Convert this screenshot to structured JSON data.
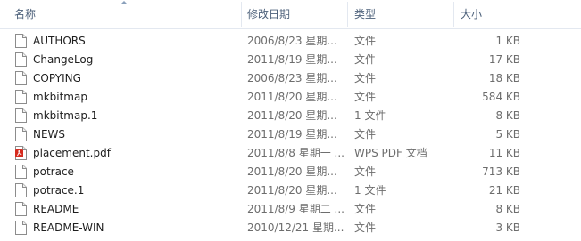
{
  "columns": {
    "name": "名称",
    "date": "修改日期",
    "type": "类型",
    "size": "大小"
  },
  "files": [
    {
      "name": "AUTHORS",
      "date": "2006/8/23 星期...",
      "type": "文件",
      "size": "1 KB",
      "icon": "file-icon"
    },
    {
      "name": "ChangeLog",
      "date": "2011/8/19 星期...",
      "type": "文件",
      "size": "17 KB",
      "icon": "file-icon"
    },
    {
      "name": "COPYING",
      "date": "2006/8/23 星期...",
      "type": "文件",
      "size": "18 KB",
      "icon": "file-icon"
    },
    {
      "name": "mkbitmap",
      "date": "2011/8/20 星期...",
      "type": "文件",
      "size": "584 KB",
      "icon": "file-icon"
    },
    {
      "name": "mkbitmap.1",
      "date": "2011/8/20 星期...",
      "type": "1 文件",
      "size": "8 KB",
      "icon": "file-icon"
    },
    {
      "name": "NEWS",
      "date": "2011/8/19 星期...",
      "type": "文件",
      "size": "5 KB",
      "icon": "file-icon"
    },
    {
      "name": "placement.pdf",
      "date": "2011/8/8 星期一 ...",
      "type": "WPS PDF 文档",
      "size": "11 KB",
      "icon": "pdf-icon"
    },
    {
      "name": "potrace",
      "date": "2011/8/20 星期...",
      "type": "文件",
      "size": "713 KB",
      "icon": "file-icon"
    },
    {
      "name": "potrace.1",
      "date": "2011/8/20 星期...",
      "type": "1 文件",
      "size": "21 KB",
      "icon": "file-icon"
    },
    {
      "name": "README",
      "date": "2011/8/9 星期二 ...",
      "type": "文件",
      "size": "8 KB",
      "icon": "file-icon"
    },
    {
      "name": "README-WIN",
      "date": "2010/12/21 星期...",
      "type": "文件",
      "size": "3 KB",
      "icon": "file-icon"
    }
  ],
  "colors": {
    "header_text": "#4c607a",
    "separator": "#e3e8f0",
    "pdf_red": "#d62b1f"
  }
}
